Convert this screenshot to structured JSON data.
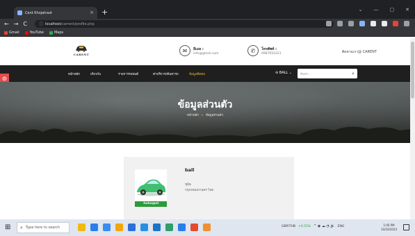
{
  "browser": {
    "tab_title": "Cent Khojatrast",
    "tab_close": "×",
    "new_tab": "+",
    "window_controls": [
      "⌄",
      "—",
      "▢",
      "✕"
    ],
    "nav": {
      "back": "←",
      "forward": "→",
      "reload": "C"
    },
    "omnibox": {
      "host": "localhost",
      "path": "/carrent/profile.php"
    },
    "bookmarks": [
      {
        "label": "Gmail",
        "color": "#ea4335"
      },
      {
        "label": "YouTube",
        "color": "#ff0000"
      },
      {
        "label": "Maps",
        "color": "#34a853"
      }
    ],
    "ext_colors": [
      "#9aa0a6",
      "#9aa0a6",
      "#9aa0a6",
      "#8ab4f8",
      "#e8eaed",
      "#e8eaed",
      "#ea4335",
      "#9aa0a6"
    ]
  },
  "site": {
    "logo_text": "CARENT",
    "contact_email": {
      "label": "อีเมล :",
      "value": "info@gmail.com",
      "icon": "✉"
    },
    "contact_phone": {
      "label": "โทรศัพท์ :",
      "value": "0987654321",
      "icon": "✆"
    },
    "follow_text": "ติดตามเรา@ CARENT",
    "nav_items": [
      "หน้าหลัก",
      "เกี่ยวกับ",
      "รายการรถยนต์",
      "ค่าบริการ/ค้นหารถ",
      "ข้อมูลติดต่อ"
    ],
    "user_menu": "⊖ BALL ⌄",
    "search_placeholder": "ค้นหา...",
    "search_icon": "⌕",
    "side_badge_icon": "⚙"
  },
  "hero": {
    "title": "ข้อมูลส่วนตัว",
    "breadcrumb_home": "หน้าหลัก",
    "breadcrumb_sep": ">",
    "breadcrumb_current": "ข้อมูลส่วนตัว"
  },
  "profile": {
    "brand": "Autospot",
    "name": "ball",
    "line1": "ชุมิด",
    "line2": "กรุงเทพมหานคร ไทย"
  },
  "taskbar": {
    "start_icon": "⊞",
    "search_icon": "⌕",
    "search_placeholder": "Type here to search",
    "stock": "GBP/THB",
    "stock_change": "+0.55%",
    "tray_icons": "^ ◉ ☁ ◔ 🔊",
    "lang": "ENG",
    "time": "1:00 PM",
    "date": "10/16/2024",
    "app_colors": [
      "#f2b90f",
      "#2b7de9",
      "#3c8cf0",
      "#f2a60c",
      "#2f6ed7",
      "#2a8ee0",
      "#1f73c6",
      "#2f9e6a",
      "#2b7de9",
      "#e34a2e",
      "#f09030"
    ]
  }
}
